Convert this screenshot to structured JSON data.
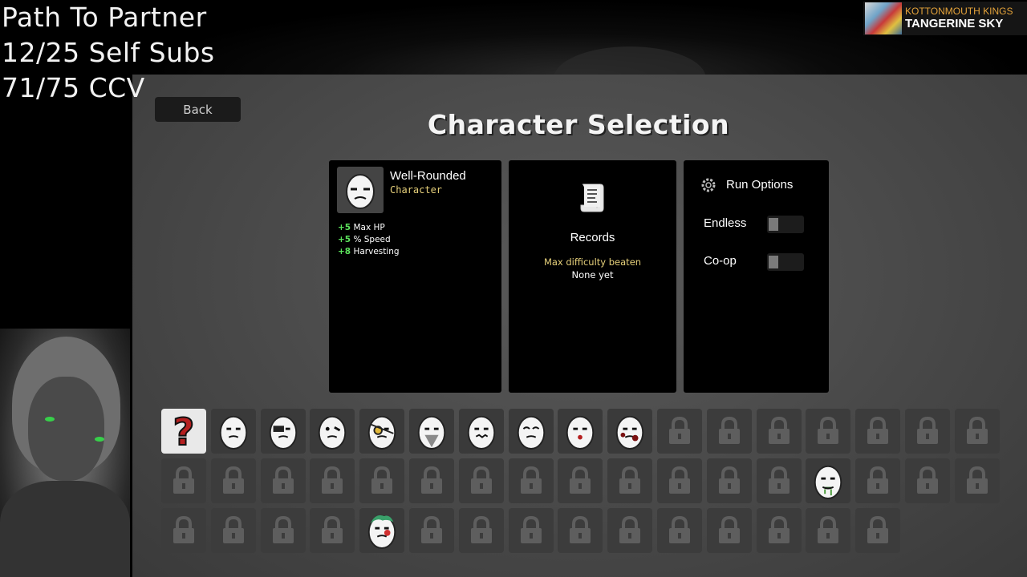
{
  "overlay": {
    "goal_line1": "Path To Partner",
    "goal_line2": "12/25 Self Subs",
    "goal_line3": "71/75 CCV"
  },
  "now_playing": {
    "album_art_text": "Kottonmouth Kings",
    "artist": "KOTTONMOUTH KINGS",
    "song": "TANGERINE SKY"
  },
  "header": {
    "back_label": "Back",
    "title": "Character Selection"
  },
  "character": {
    "name": "Well-Rounded",
    "type_label": "Character",
    "stats": [
      {
        "value": "+5",
        "label": "Max HP"
      },
      {
        "value": "+5",
        "label": "% Speed"
      },
      {
        "value": "+8",
        "label": "Harvesting"
      }
    ]
  },
  "records": {
    "title": "Records",
    "max_difficulty_label": "Max difficulty beaten",
    "max_difficulty_value": "None yet"
  },
  "run_options": {
    "title": "Run Options",
    "options": [
      {
        "label": "Endless",
        "enabled": false
      },
      {
        "label": "Co-op",
        "enabled": false
      }
    ]
  },
  "grid": {
    "rows": [
      [
        "random",
        "well-rounded",
        "brawler",
        "crazy",
        "ranger",
        "mage",
        "chunky",
        "old",
        "lucky",
        "mutant",
        "locked",
        "locked",
        "locked",
        "locked",
        "locked",
        "locked",
        "locked"
      ],
      [
        "locked",
        "locked",
        "locked",
        "locked",
        "locked",
        "locked",
        "locked",
        "locked",
        "locked",
        "locked",
        "locked",
        "locked",
        "locked",
        "drooling",
        "locked",
        "locked",
        "locked"
      ],
      [
        "locked",
        "locked",
        "locked",
        "locked",
        "char-green-hair",
        "locked",
        "locked",
        "locked",
        "locked",
        "locked",
        "locked",
        "locked",
        "locked",
        "locked",
        "locked"
      ]
    ],
    "icons": {
      "random": "question-mark-icon",
      "locked": "padlock-icon"
    }
  },
  "colors": {
    "stat_value": "#5ce35c",
    "accent_yellow": "#e6d07a",
    "artist_orange": "#e5a33a",
    "random_qmark": "#b52020"
  }
}
